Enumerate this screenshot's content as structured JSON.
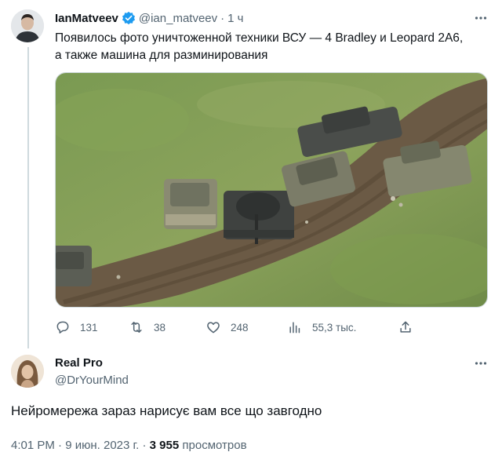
{
  "tweet": {
    "author_name": "IanMatveev",
    "author_handle": "@ian_matveev",
    "separator": "·",
    "time": "1 ч",
    "text_line1": "Появилось фото уничтоженной техники ВСУ — 4 Bradley и Leopard 2А6,",
    "text_line2": "а также машина для разминирования",
    "actions": {
      "replies": "131",
      "retweets": "38",
      "likes": "248",
      "views": "55,3 тыс."
    }
  },
  "reply": {
    "author_name": "Real Pro",
    "author_handle": "@DrYourMind",
    "text": "Нейромережа зараз нарисує вам все що завгодно",
    "timestamp": "4:01 PM",
    "separator": "·",
    "date": "9 июн. 2023 г.",
    "separator2": "·",
    "views_count": "3 955",
    "views_label": "просмотров"
  },
  "colors": {
    "text_primary": "#0f1419",
    "text_secondary": "#536471",
    "verified_blue": "#1d9bf0",
    "border": "#cfd9de"
  }
}
